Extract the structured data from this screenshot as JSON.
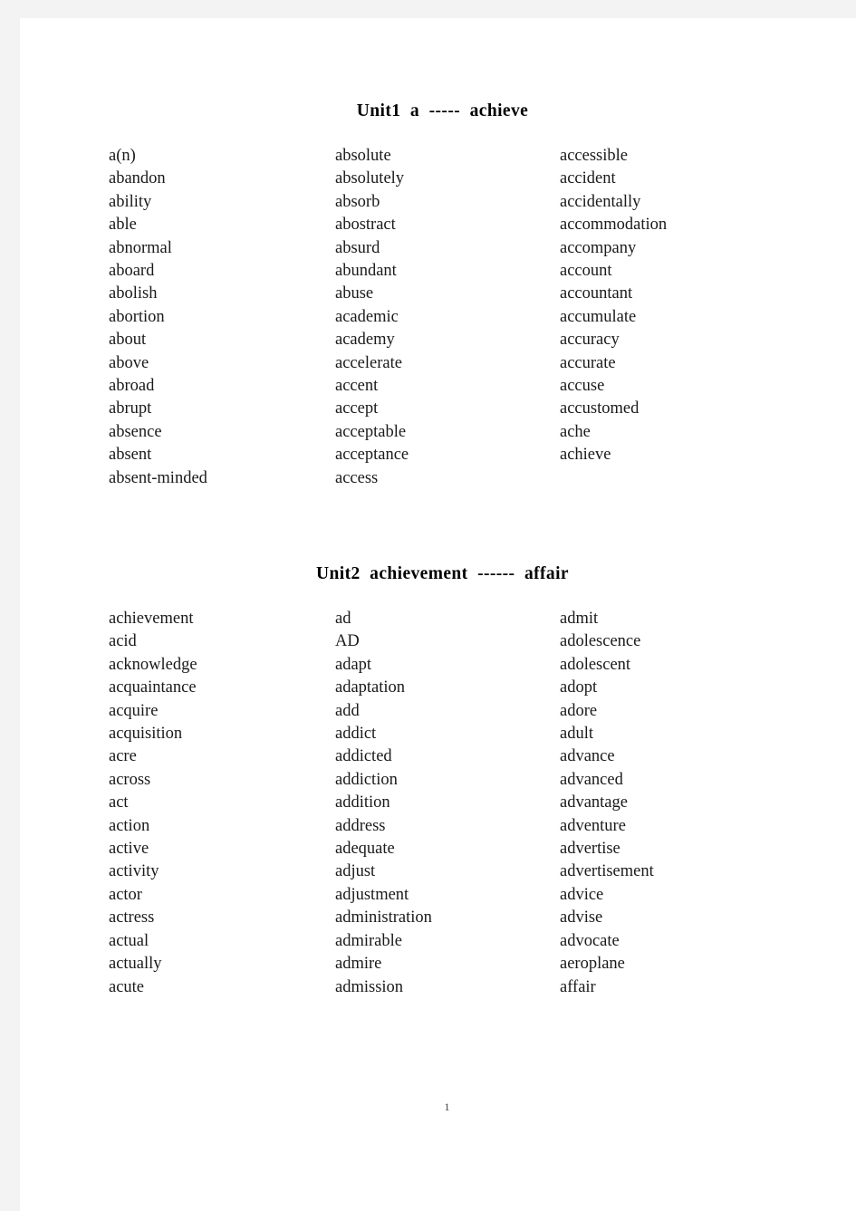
{
  "document": {
    "page_number": "1",
    "background_color": "#f3f3f3",
    "sheet_color": "#ffffff",
    "text_color": "#1a1a1a"
  },
  "units": [
    {
      "heading": "Unit1  a  -----  achieve",
      "columns": [
        {
          "words": [
            "a(n)",
            "abandon",
            "ability",
            "able",
            "abnormal",
            "aboard",
            "abolish",
            "abortion",
            "about",
            "above",
            "abroad",
            "abrupt",
            "absence",
            "absent",
            "absent-minded"
          ]
        },
        {
          "words": [
            "absolute",
            "absolutely",
            "absorb",
            "abostract",
            "absurd",
            "abundant",
            "abuse",
            "academic",
            "academy",
            "accelerate",
            "accent",
            "accept",
            "acceptable",
            "acceptance",
            "access"
          ]
        },
        {
          "words": [
            "accessible",
            "accident",
            "accidentally",
            "accommodation",
            "accompany",
            "account",
            "accountant",
            "accumulate",
            "accuracy",
            "accurate",
            "accuse",
            "accustomed",
            "ache",
            "achieve"
          ]
        }
      ]
    },
    {
      "heading": "Unit2  achievement  ------  affair",
      "columns": [
        {
          "words": [
            "achievement",
            "acid",
            "acknowledge",
            "acquaintance",
            "acquire",
            "acquisition",
            "acre",
            "across",
            "act",
            "action",
            "active",
            "activity",
            "actor",
            "actress",
            "actual",
            "actually",
            "acute"
          ]
        },
        {
          "words": [
            "ad",
            "AD",
            "adapt",
            "adaptation",
            "add",
            "addict",
            "addicted",
            "addiction",
            "addition",
            "address",
            "adequate",
            "adjust",
            "adjustment",
            "administration",
            "admirable",
            "admire",
            "admission"
          ]
        },
        {
          "words": [
            "admit",
            "adolescence",
            "adolescent",
            "adopt",
            "adore",
            "adult",
            "advance",
            "advanced",
            "advantage",
            "adventure",
            "advertise",
            "advertisement",
            "advice",
            "advise",
            "advocate",
            "aeroplane",
            "affair"
          ]
        }
      ]
    }
  ]
}
